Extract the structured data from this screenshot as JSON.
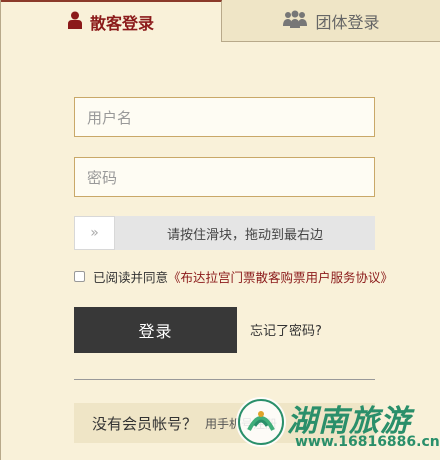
{
  "tabs": {
    "individual_label": "散客登录",
    "individual_icon": "user-icon",
    "group_label": "团体登录",
    "group_icon": "group-icon"
  },
  "form": {
    "username_placeholder": "用户名",
    "password_placeholder": "密码",
    "slider_handle": "»",
    "slider_text": "请按住滑块，拖动到最右边",
    "agree_prefix": "已阅读并同意",
    "agree_link": "《布达拉宫门票散客购票用户服务协议》",
    "login_label": "登录",
    "forgot_label": "忘记了密码?"
  },
  "register": {
    "prompt": "没有会员帐号？",
    "sub": "用手机号注册"
  },
  "watermark": {
    "brand": "湖南旅游",
    "url": "www.16816886.cn"
  },
  "colors": {
    "accent": "#8b1a1a",
    "background": "#f9f1d9",
    "button": "#383838",
    "watermark": "#2a8f6a"
  }
}
